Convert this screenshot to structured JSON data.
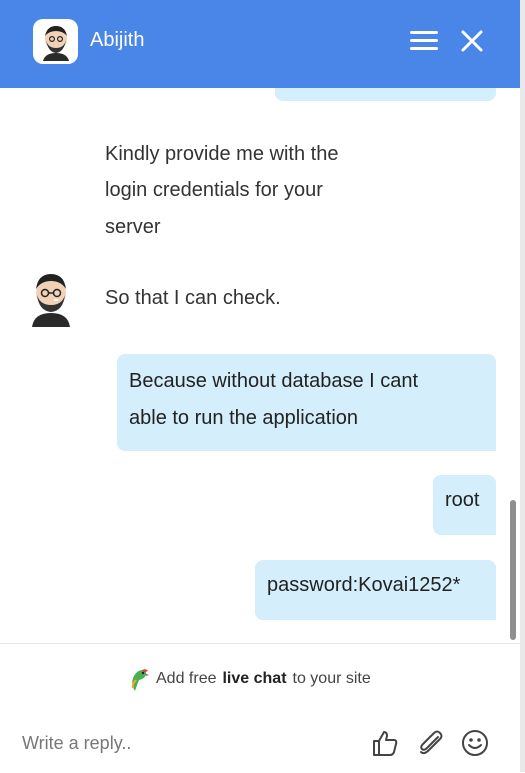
{
  "header": {
    "agent_name": "Abijith"
  },
  "messages": {
    "agent": [
      "Kindly provide me with the",
      "login credentials for your",
      "server",
      "So that I can check."
    ],
    "user": [
      {
        "lines": [
          "Because without database I cant",
          "able to run the application"
        ]
      },
      {
        "lines": [
          "root"
        ]
      },
      {
        "lines": [
          "password:Kovai1252*"
        ]
      }
    ]
  },
  "footer": {
    "promo_prefix": "Add free",
    "promo_bold": "live chat",
    "promo_suffix": "to your site",
    "reply_placeholder": "Write a reply.."
  },
  "icons": {
    "menu": "hamburger-menu-icon",
    "close": "close-icon",
    "like": "thumbs-up-icon",
    "attach": "paperclip-icon",
    "emoji": "smiley-icon",
    "promo": "parrot-logo-icon"
  },
  "colors": {
    "header": "#4a86e8",
    "user_bubble": "#d4eefc"
  }
}
